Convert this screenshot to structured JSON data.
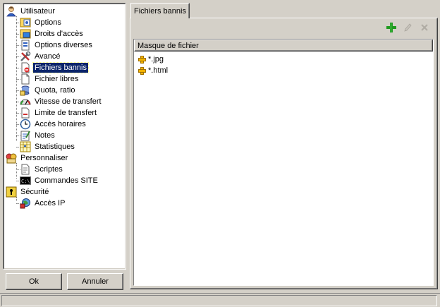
{
  "tree": {
    "items": [
      {
        "label": "Utilisateur",
        "icon": "user-icon",
        "level": 0
      },
      {
        "label": "Options",
        "icon": "options-icon",
        "level": 1
      },
      {
        "label": "Droits d'accès",
        "icon": "access-rights-icon",
        "level": 1
      },
      {
        "label": "Options diverses",
        "icon": "misc-options-icon",
        "level": 1
      },
      {
        "label": "Avancé",
        "icon": "tools-icon",
        "level": 1
      },
      {
        "label": "Fichiers bannis",
        "icon": "banned-files-icon",
        "level": 1,
        "selected": true
      },
      {
        "label": "Fichier libres",
        "icon": "free-file-icon",
        "level": 1
      },
      {
        "label": "Quota, ratio",
        "icon": "quota-icon",
        "level": 1
      },
      {
        "label": "Vitesse de transfert",
        "icon": "speed-gauge-icon",
        "level": 1
      },
      {
        "label": "Limite de transfert",
        "icon": "transfer-limit-icon",
        "level": 1
      },
      {
        "label": "Accès horaires",
        "icon": "clock-icon",
        "level": 1
      },
      {
        "label": "Notes",
        "icon": "notes-icon",
        "level": 1
      },
      {
        "label": "Statistiques",
        "icon": "statistics-icon",
        "level": 1
      },
      {
        "label": "Personnaliser",
        "icon": "customize-icon",
        "level": 0
      },
      {
        "label": "Scriptes",
        "icon": "scripts-icon",
        "level": 1
      },
      {
        "label": "Commandes SITE",
        "icon": "console-icon",
        "level": 1
      },
      {
        "label": "Sécurité",
        "icon": "security-icon",
        "level": 0
      },
      {
        "label": "Accès IP",
        "icon": "ip-access-icon",
        "level": 1
      }
    ]
  },
  "buttons": {
    "ok": "Ok",
    "cancel": "Annuler"
  },
  "tab": {
    "label": "Fichiers bannis"
  },
  "toolbar": {
    "add_icon": "plus-icon",
    "edit_icon": "pencil-icon",
    "delete_icon": "delete-icon"
  },
  "list": {
    "column_header": "Masque de fichier",
    "rows": [
      "*.jpg",
      "*.html"
    ]
  },
  "colors": {
    "selection": "#0a246a",
    "face": "#d4d0c8",
    "add": "#1f9a1f"
  }
}
